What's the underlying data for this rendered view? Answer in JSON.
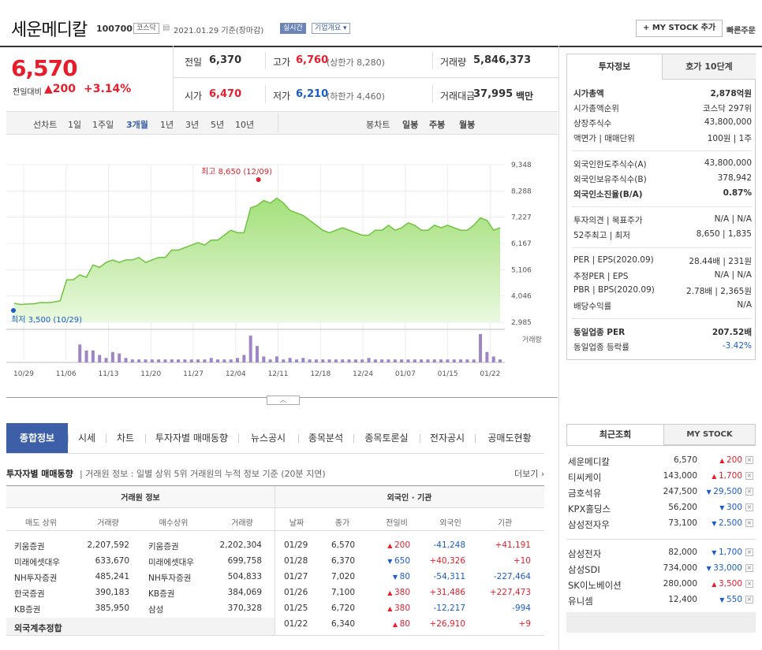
{
  "header": {
    "name": "세운메디칼",
    "code": "100700",
    "market": "코스닥",
    "date": "2021.01.29 기준(장마감)",
    "realtime": "실시간",
    "company_overview": "기업개요",
    "my_stock_button": "+ MY STOCK 추가",
    "quick_order": "빠른주문"
  },
  "price": {
    "current": "6,570",
    "change_label": "전일대비",
    "change": "200",
    "change_pct": "+3.14%",
    "prev_label": "전일",
    "prev": "6,370",
    "high_label": "고가",
    "high": "6,760",
    "upper_limit": "(상한가 8,280)",
    "volume_label": "거래량",
    "volume": "5,846,373",
    "open_label": "시가",
    "open": "6,470",
    "low_label": "저가",
    "low": "6,210",
    "lower_limit": "(하한가 4,460)",
    "amount_label": "거래대금",
    "amount": "37,995",
    "amount_unit": "백만"
  },
  "chart_tabs": {
    "line_label": "선차트",
    "periods": [
      "1일",
      "1주일",
      "3개월",
      "1년",
      "3년",
      "5년",
      "10년"
    ],
    "selected": "3개월",
    "candle_label": "봉차트",
    "candle_periods": [
      "일봉",
      "주봉",
      "월봉"
    ]
  },
  "chart_data": {
    "type": "area",
    "y_ticks": [
      "9,348",
      "8,288",
      "7,227",
      "6,167",
      "5,106",
      "4,046",
      "2,985"
    ],
    "ylim": [
      2985,
      9348
    ],
    "x_ticks": [
      "10/29",
      "11/06",
      "11/13",
      "11/20",
      "11/27",
      "12/04",
      "12/11",
      "12/18",
      "12/24",
      "01/07",
      "01/15",
      "01/22"
    ],
    "max_label": "최고 8,650 (12/09)",
    "min_label": "최저 3,500 (10/29)",
    "volume_label": "거래량",
    "values": [
      3750,
      3700,
      3720,
      3730,
      3780,
      3770,
      3800,
      3850,
      4700,
      4700,
      4900,
      4800,
      5300,
      5200,
      5400,
      5500,
      5400,
      5500,
      5500,
      5600,
      5400,
      5500,
      5600,
      5600,
      5900,
      5900,
      6000,
      6100,
      6200,
      6100,
      6300,
      6300,
      6500,
      6700,
      6600,
      6600,
      7600,
      7700,
      7900,
      7800,
      8000,
      7800,
      7500,
      7400,
      7300,
      7100,
      6900,
      6700,
      6600,
      6700,
      6800,
      6700,
      6600,
      6500,
      6500,
      6700,
      6700,
      6900,
      6700,
      6800,
      7000,
      6900,
      6700,
      6700,
      6900,
      6800,
      6900,
      6800,
      6700,
      6700,
      6900,
      7200,
      7100,
      6700,
      6800
    ],
    "volumes": [
      0,
      0,
      0,
      0,
      0,
      0,
      0,
      0,
      0,
      0,
      60,
      40,
      40,
      25,
      15,
      35,
      30,
      15,
      10,
      10,
      10,
      10,
      10,
      10,
      10,
      10,
      10,
      10,
      10,
      10,
      15,
      10,
      10,
      10,
      15,
      25,
      90,
      55,
      20,
      10,
      20,
      10,
      15,
      10,
      15,
      10,
      10,
      10,
      10,
      10,
      10,
      10,
      10,
      10,
      15,
      10,
      10,
      10,
      10,
      10,
      10,
      10,
      10,
      10,
      10,
      10,
      10,
      10,
      10,
      10,
      10,
      95,
      35,
      20,
      10
    ]
  },
  "info_panel": {
    "tabs": [
      "투자정보",
      "호가 10단계"
    ],
    "rows": [
      {
        "k": "시가총액",
        "v": "2,878억원",
        "bold": true
      },
      {
        "k": "시가총액순위",
        "v": "코스닥 297위"
      },
      {
        "k": "상장주식수",
        "v": "43,800,000"
      },
      {
        "k": "액면가 | 매매단위",
        "v": "100원 | 1주"
      },
      {
        "k": "외국인한도주식수(A)",
        "v": "43,800,000"
      },
      {
        "k": "외국인보유주식수(B)",
        "v": "378,942"
      },
      {
        "k": "외국인소진율(B/A)",
        "v": "0.87%",
        "bold": true
      },
      {
        "k": "투자의견 | 목표주가",
        "v": "N/A | N/A"
      },
      {
        "k": "52주최고 | 최저",
        "v": "8,650 | 1,835"
      },
      {
        "k": "PER | EPS(2020.09)",
        "v": "28.44배 | 231원"
      },
      {
        "k": "추정PER | EPS",
        "v": "N/A | N/A"
      },
      {
        "k": "PBR | BPS(2020.09)",
        "v": "2.78배 | 2,365원"
      },
      {
        "k": "배당수익률",
        "v": "N/A"
      },
      {
        "k": "동일업종 PER",
        "v": "207.52배",
        "bold": true
      },
      {
        "k": "동일업종 등락률",
        "v": "-3.42%"
      }
    ]
  },
  "bottom_tabs": [
    "종합정보",
    "시세",
    "차트",
    "투자자별 매매동향",
    "뉴스공시",
    "종목분석",
    "종목토론실",
    "전자공시",
    "공매도현황"
  ],
  "investor": {
    "title": "투자자별 매매동향",
    "desc": "거래원 정보 : 일별 상위 5위 거래원의 누적 정보 기준 (20분 지연)",
    "more": "더보기",
    "group1": "거래원 정보",
    "group2": "외국인 · 기관",
    "cols": [
      "매도 상위",
      "거래량",
      "매수상위",
      "거래량",
      "날짜",
      "종가",
      "전일비",
      "외국인",
      "기관"
    ],
    "brokers": [
      [
        "키움증권",
        "2,207,592",
        "키움증권",
        "2,202,304"
      ],
      [
        "미래에셋대우",
        "633,670",
        "미래에셋대우",
        "699,758"
      ],
      [
        "NH투자증권",
        "485,241",
        "NH투자증권",
        "504,833"
      ],
      [
        "한국증권",
        "390,183",
        "KB증권",
        "384,069"
      ],
      [
        "KB증권",
        "385,950",
        "삼성",
        "370,328"
      ]
    ],
    "foreign_total": "외국계추정합",
    "daily": [
      {
        "date": "01/29",
        "close": "6,570",
        "dir": "up",
        "diff": "200",
        "foreign": "-41,248",
        "inst": "+41,191"
      },
      {
        "date": "01/28",
        "close": "6,370",
        "dir": "down",
        "diff": "650",
        "foreign": "+40,326",
        "inst": "+10"
      },
      {
        "date": "01/27",
        "close": "7,020",
        "dir": "down",
        "diff": "80",
        "foreign": "-54,311",
        "inst": "-227,464"
      },
      {
        "date": "01/26",
        "close": "7,100",
        "dir": "up",
        "diff": "380",
        "foreign": "+31,486",
        "inst": "+227,473"
      },
      {
        "date": "01/25",
        "close": "6,720",
        "dir": "up",
        "diff": "380",
        "foreign": "-12,217",
        "inst": "-994"
      },
      {
        "date": "01/22",
        "close": "6,340",
        "dir": "up",
        "diff": "80",
        "foreign": "+26,910",
        "inst": "+9"
      }
    ]
  },
  "recent": {
    "tabs": [
      "최근조회",
      "MY STOCK"
    ],
    "group1": [
      {
        "name": "세운메디칼",
        "price": "6,570",
        "dir": "up",
        "diff": "200"
      },
      {
        "name": "티씨케이",
        "price": "143,000",
        "dir": "up",
        "diff": "1,700"
      },
      {
        "name": "금호석유",
        "price": "247,500",
        "dir": "down",
        "diff": "29,500"
      },
      {
        "name": "KPX홀딩스",
        "price": "56,200",
        "dir": "down",
        "diff": "300"
      },
      {
        "name": "삼성전자우",
        "price": "73,100",
        "dir": "down",
        "diff": "2,500"
      }
    ],
    "group2": [
      {
        "name": "삼성전자",
        "price": "82,000",
        "dir": "down",
        "diff": "1,700"
      },
      {
        "name": "삼성SDI",
        "price": "734,000",
        "dir": "down",
        "diff": "33,000"
      },
      {
        "name": "SK이노베이션",
        "price": "280,000",
        "dir": "up",
        "diff": "3,500"
      },
      {
        "name": "유니셈",
        "price": "12,400",
        "dir": "down",
        "diff": "550"
      }
    ]
  }
}
